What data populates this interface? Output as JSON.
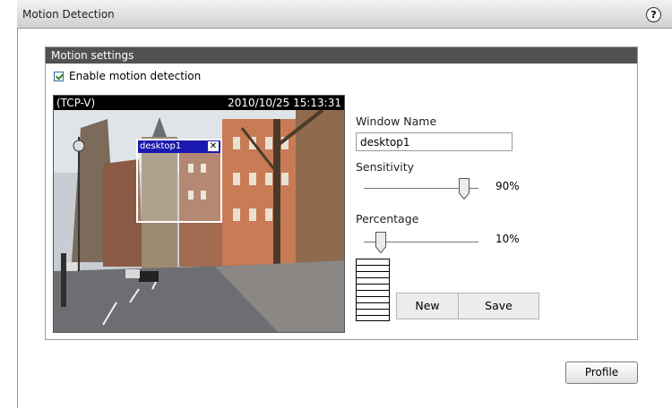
{
  "window": {
    "title": "Motion Detection",
    "help_glyph": "?"
  },
  "panel": {
    "header": "Motion settings"
  },
  "enable": {
    "label": "Enable motion detection",
    "checked": true
  },
  "video": {
    "protocol": "(TCP-V)",
    "timestamp": "2010/10/25 15:13:31"
  },
  "motion_window": {
    "name": "desktop1",
    "close_glyph": "✕"
  },
  "window_name": {
    "label": "Window Name",
    "value": "desktop1"
  },
  "sensitivity": {
    "label": "Sensitivity",
    "value_text": "90%",
    "value": 90
  },
  "percentage": {
    "label": "Percentage",
    "value_text": "10%",
    "value": 10
  },
  "buttons": {
    "new": "New",
    "save": "Save",
    "profile": "Profile"
  },
  "colors": {
    "panel_header": "#525252",
    "motion_window_title": "#1a1ab0",
    "video_bar": "#000000"
  }
}
